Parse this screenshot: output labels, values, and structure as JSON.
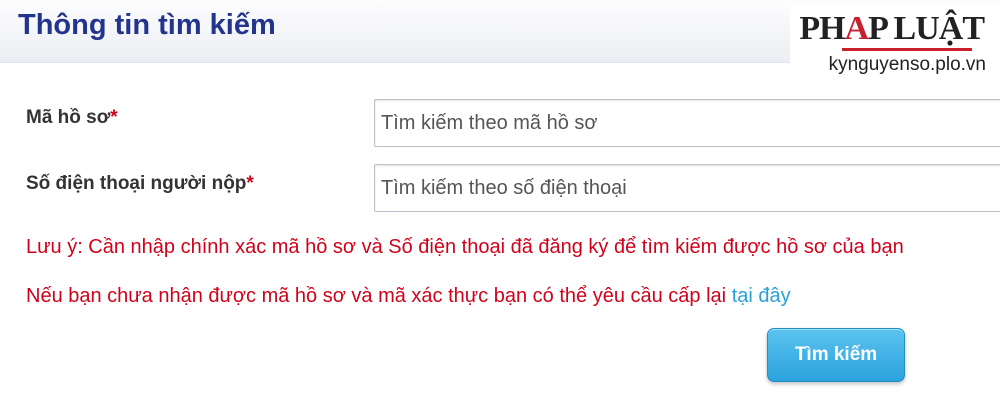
{
  "header": {
    "title": "Thông tin tìm kiếm"
  },
  "brand": {
    "logo_left": "PH",
    "logo_mark": "A",
    "logo_right": "P LUẬT",
    "site": "kynguyenso.plo.vn"
  },
  "form": {
    "record_code": {
      "label": "Mã hồ sơ",
      "required_mark": "*",
      "placeholder": "Tìm kiếm theo mã hồ sơ",
      "value": ""
    },
    "phone": {
      "label": "Số điện thoại người nộp",
      "required_mark": "*",
      "placeholder": "Tìm kiếm theo số điện thoại",
      "value": ""
    }
  },
  "notes": {
    "note1": "Lưu ý: Cần nhập chính xác mã hồ sơ và Số điện thoại đã đăng ký để tìm kiếm được hồ sơ của bạn",
    "note2": "Nếu bạn chưa nhận được mã hồ sơ và mã xác thực bạn có thể yêu cầu cấp lại ",
    "note2_link": "tại đây"
  },
  "actions": {
    "search_label": "Tìm kiếm"
  },
  "colors": {
    "title": "#23348c",
    "warning": "#d0021b",
    "link": "#2a9fd8",
    "button": "#2aa2dc"
  }
}
